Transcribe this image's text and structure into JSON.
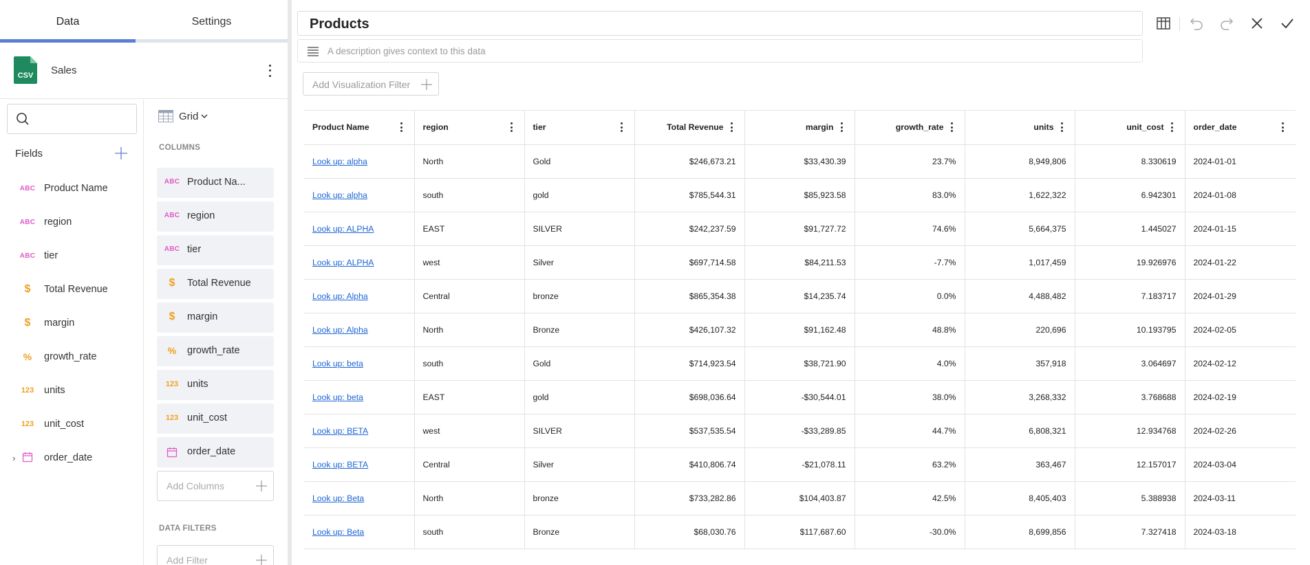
{
  "tabs": {
    "data": "Data",
    "settings": "Settings"
  },
  "datasource": {
    "icon_text": "CSV",
    "name": "Sales"
  },
  "fields": {
    "title": "Fields",
    "items": [
      {
        "icon": "abc-icon",
        "icon_text": "ABC",
        "label": "Product Name"
      },
      {
        "icon": "abc-icon",
        "icon_text": "ABC",
        "label": "region"
      },
      {
        "icon": "abc-icon",
        "icon_text": "ABC",
        "label": "tier"
      },
      {
        "icon": "dollar-icon",
        "icon_text": "$",
        "label": "Total Revenue"
      },
      {
        "icon": "dollar-icon",
        "icon_text": "$",
        "label": "margin"
      },
      {
        "icon": "percent-icon",
        "icon_text": "%",
        "label": "growth_rate"
      },
      {
        "icon": "number-icon",
        "icon_text": "123",
        "label": "units"
      },
      {
        "icon": "number-icon",
        "icon_text": "123",
        "label": "unit_cost"
      },
      {
        "icon": "calendar-icon",
        "icon_text": "",
        "label": "order_date"
      }
    ]
  },
  "viz_selector": {
    "label": "Grid"
  },
  "columns_section": {
    "title": "COLUMNS",
    "items": [
      {
        "icon_text": "ABC",
        "label": "Product Na..."
      },
      {
        "icon_text": "ABC",
        "label": "region"
      },
      {
        "icon_text": "ABC",
        "label": "tier"
      },
      {
        "icon_text": "$",
        "label": "Total Revenue"
      },
      {
        "icon_text": "$",
        "label": "margin"
      },
      {
        "icon_text": "%",
        "label": "growth_rate"
      },
      {
        "icon_text": "123",
        "label": "units"
      },
      {
        "icon_text": "123",
        "label": "unit_cost"
      },
      {
        "icon_text": "",
        "label": "order_date"
      }
    ],
    "add_label": "Add Columns"
  },
  "data_filters": {
    "title": "DATA FILTERS",
    "add_label": "Add Filter"
  },
  "header": {
    "title": "Products",
    "description_placeholder": "A description gives context to this data"
  },
  "viz_filter": {
    "label": "Add Visualization Filter"
  },
  "colors": {
    "accent": "#5b7fd6",
    "link": "#1a65d6",
    "csv_green": "#1e8a5e",
    "abc": "#e05bc6",
    "numeric": "#f0a020"
  },
  "table": {
    "headers": [
      "Product Name",
      "region",
      "tier",
      "Total Revenue",
      "margin",
      "growth_rate",
      "units",
      "unit_cost",
      "order_date"
    ],
    "rows": [
      [
        "Look up: alpha",
        "North",
        "Gold",
        "$246,673.21",
        "$33,430.39",
        "23.7%",
        "8,949,806",
        "8.330619",
        "2024-01-01"
      ],
      [
        "Look up: alpha",
        "south",
        "gold",
        "$785,544.31",
        "$85,923.58",
        "83.0%",
        "1,622,322",
        "6.942301",
        "2024-01-08"
      ],
      [
        "Look up: ALPHA",
        "EAST",
        "SILVER",
        "$242,237.59",
        "$91,727.72",
        "74.6%",
        "5,664,375",
        "1.445027",
        "2024-01-15"
      ],
      [
        "Look up: ALPHA",
        "west",
        "Silver",
        "$697,714.58",
        "$84,211.53",
        "-7.7%",
        "1,017,459",
        "19.926976",
        "2024-01-22"
      ],
      [
        "Look up: Alpha",
        "Central",
        "bronze",
        "$865,354.38",
        "$14,235.74",
        "0.0%",
        "4,488,482",
        "7.183717",
        "2024-01-29"
      ],
      [
        "Look up: Alpha",
        "North",
        "Bronze",
        "$426,107.32",
        "$91,162.48",
        "48.8%",
        "220,696",
        "10.193795",
        "2024-02-05"
      ],
      [
        "Look up: beta",
        "south",
        "Gold",
        "$714,923.54",
        "$38,721.90",
        "4.0%",
        "357,918",
        "3.064697",
        "2024-02-12"
      ],
      [
        "Look up: beta",
        "EAST",
        "gold",
        "$698,036.64",
        "-$30,544.01",
        "38.0%",
        "3,268,332",
        "3.768688",
        "2024-02-19"
      ],
      [
        "Look up: BETA",
        "west",
        "SILVER",
        "$537,535.54",
        "-$33,289.85",
        "44.7%",
        "6,808,321",
        "12.934768",
        "2024-02-26"
      ],
      [
        "Look up: BETA",
        "Central",
        "Silver",
        "$410,806.74",
        "-$21,078.11",
        "63.2%",
        "363,467",
        "12.157017",
        "2024-03-04"
      ],
      [
        "Look up: Beta",
        "North",
        "bronze",
        "$733,282.86",
        "$104,403.87",
        "42.5%",
        "8,405,403",
        "5.388938",
        "2024-03-11"
      ],
      [
        "Look up: Beta",
        "south",
        "Bronze",
        "$68,030.76",
        "$117,687.60",
        "-30.0%",
        "8,699,856",
        "7.327418",
        "2024-03-18"
      ]
    ]
  }
}
